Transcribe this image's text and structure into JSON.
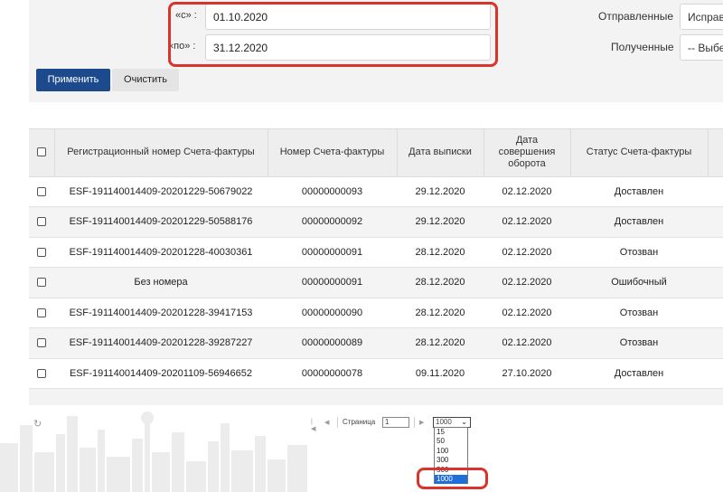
{
  "filter": {
    "from_label": "«с» :",
    "from_value": "01.10.2020",
    "to_label": "«по» :",
    "to_value": "31.12.2020",
    "sent_label": "Отправленные",
    "sent_value": "Исправ",
    "received_label": "Полученные",
    "received_value": "-- Выбер"
  },
  "buttons": {
    "apply": "Применить",
    "clear": "Очистить"
  },
  "table": {
    "columns": [
      "Регистрационный номер Счета-фактуры",
      "Номер Счета-фактуры",
      "Дата выписки",
      "Дата совершения оборота",
      "Статус Счета-фактуры"
    ],
    "rows": [
      {
        "reg": "ESF-191140014409-20201229-50679022",
        "num": "00000000093",
        "issue": "29.12.2020",
        "turnover": "02.12.2020",
        "status": "Доставлен"
      },
      {
        "reg": "ESF-191140014409-20201229-50588176",
        "num": "00000000092",
        "issue": "29.12.2020",
        "turnover": "02.12.2020",
        "status": "Доставлен"
      },
      {
        "reg": "ESF-191140014409-20201228-40030361",
        "num": "00000000091",
        "issue": "28.12.2020",
        "turnover": "02.12.2020",
        "status": "Отозван"
      },
      {
        "reg": "Без номера",
        "num": "00000000091",
        "issue": "28.12.2020",
        "turnover": "02.12.2020",
        "status": "Ошибочный"
      },
      {
        "reg": "ESF-191140014409-20201228-39417153",
        "num": "00000000090",
        "issue": "28.12.2020",
        "turnover": "02.12.2020",
        "status": "Отозван"
      },
      {
        "reg": "ESF-191140014409-20201228-39287227",
        "num": "00000000089",
        "issue": "28.12.2020",
        "turnover": "02.12.2020",
        "status": "Отозван"
      },
      {
        "reg": "ESF-191140014409-20201109-56946652",
        "num": "00000000078",
        "issue": "09.11.2020",
        "turnover": "27.10.2020",
        "status": "Доставлен"
      }
    ]
  },
  "pager": {
    "page_label": "Страница",
    "page_value": "1",
    "page_size_selected": "1000",
    "page_size_options": [
      "15",
      "50",
      "100",
      "300",
      "500",
      "1000"
    ],
    "first_icon": "first-page-icon",
    "prev_icon": "prev-page-icon",
    "next_icon": "next-page-icon",
    "refresh_icon": "refresh-icon"
  },
  "colors": {
    "primary": "#1d4a8c",
    "highlight": "#d9342b",
    "selected_option": "#1e6fd9"
  }
}
